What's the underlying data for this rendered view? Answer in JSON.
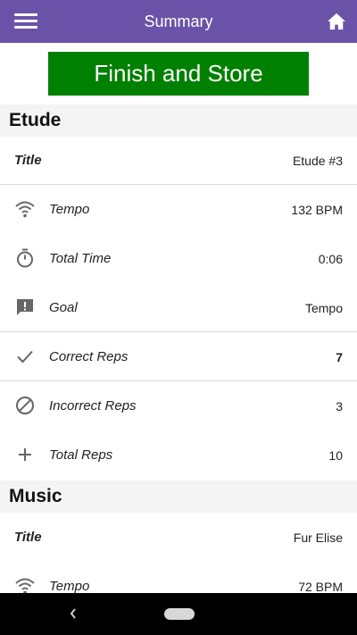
{
  "header": {
    "title": "Summary",
    "menu_icon": "menu-icon",
    "home_icon": "home-icon",
    "color": "#6a52a8"
  },
  "finish_button": {
    "label": "Finish and Store",
    "color": "#008000"
  },
  "sections": [
    {
      "name": "Etude",
      "title_row": {
        "label": "Title",
        "value": "Etude #3"
      },
      "rows": [
        {
          "icon": "wifi-icon",
          "label": "Tempo",
          "value": "132 BPM"
        },
        {
          "icon": "timer-icon",
          "label": "Total Time",
          "value": "0:06"
        },
        {
          "icon": "goal-alert-icon",
          "label": "Goal",
          "value": "Tempo"
        },
        {
          "icon": "check-icon",
          "label": "Correct Reps",
          "value": "7"
        },
        {
          "icon": "block-icon",
          "label": "Incorrect Reps",
          "value": "3"
        },
        {
          "icon": "plus-icon",
          "label": "Total Reps",
          "value": "10"
        }
      ]
    },
    {
      "name": "Music",
      "title_row": {
        "label": "Title",
        "value": "Fur Elise"
      },
      "rows": [
        {
          "icon": "wifi-icon",
          "label": "Tempo",
          "value": "72 BPM"
        }
      ]
    }
  ],
  "system_nav": {
    "back_icon": "back-icon",
    "home_icon": "home-pill-icon"
  }
}
